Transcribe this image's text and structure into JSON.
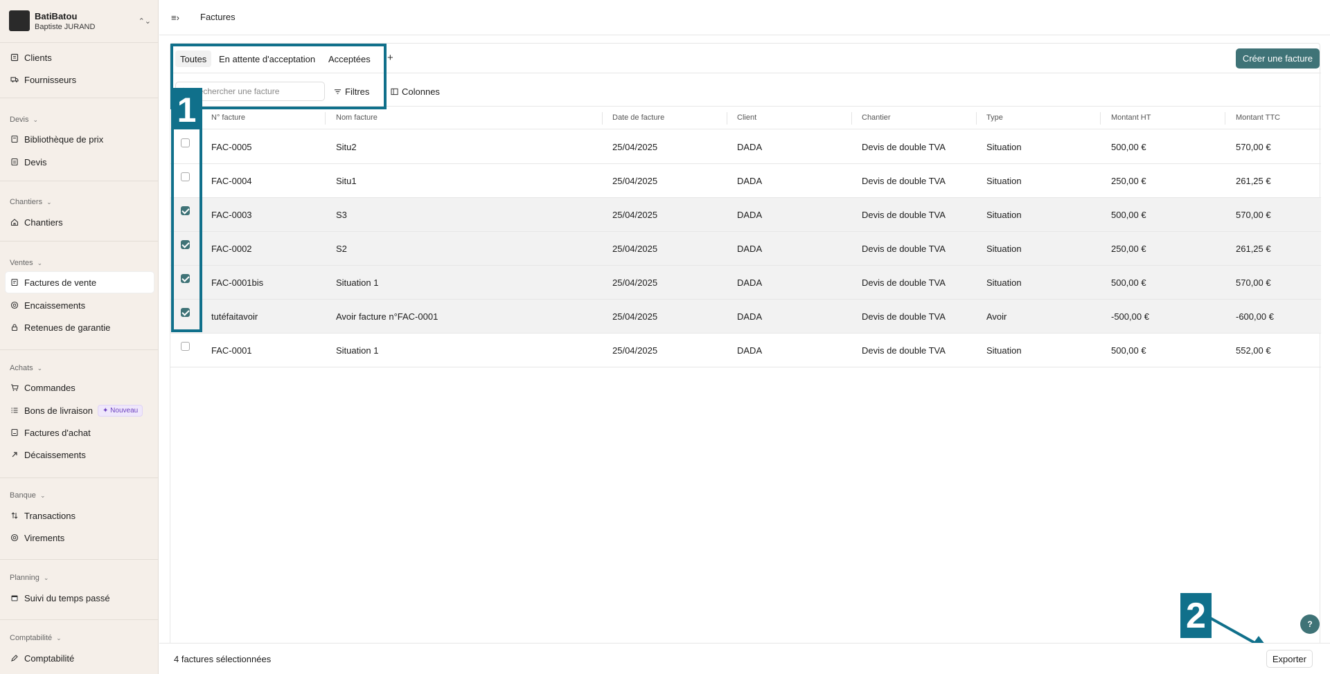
{
  "company": {
    "name": "BatiBatou",
    "user": "Baptiste JURAND"
  },
  "sidebar": {
    "top_items": [
      {
        "label": "Clients",
        "icon": "clients-icon"
      },
      {
        "label": "Fournisseurs",
        "icon": "truck-icon"
      }
    ],
    "sections": [
      {
        "label": "Devis",
        "items": [
          {
            "label": "Bibliothèque de prix",
            "icon": "book-icon"
          },
          {
            "label": "Devis",
            "icon": "document-icon"
          }
        ]
      },
      {
        "label": "Chantiers",
        "items": [
          {
            "label": "Chantiers",
            "icon": "house-icon"
          }
        ]
      },
      {
        "label": "Ventes",
        "items": [
          {
            "label": "Factures de vente",
            "icon": "invoice-icon",
            "active": true
          },
          {
            "label": "Encaissements",
            "icon": "coin-icon"
          },
          {
            "label": "Retenues de garantie",
            "icon": "lock-icon"
          }
        ]
      },
      {
        "label": "Achats",
        "items": [
          {
            "label": "Commandes",
            "icon": "cart-icon"
          },
          {
            "label": "Bons de livraison",
            "icon": "list-icon",
            "badge": "Nouveau"
          },
          {
            "label": "Factures d'achat",
            "icon": "invoice-icon"
          },
          {
            "label": "Décaissements",
            "icon": "arrow-up-right-icon"
          }
        ]
      },
      {
        "label": "Banque",
        "items": [
          {
            "label": "Transactions",
            "icon": "transfer-icon"
          },
          {
            "label": "Virements",
            "icon": "coin-icon"
          }
        ]
      },
      {
        "label": "Planning",
        "items": [
          {
            "label": "Suivi du temps passé",
            "icon": "calendar-icon"
          }
        ]
      },
      {
        "label": "Comptabilité",
        "items": [
          {
            "label": "Comptabilité",
            "icon": "pen-icon"
          }
        ]
      }
    ]
  },
  "header": {
    "title": "Factures"
  },
  "tabs": [
    "Toutes",
    "En attente d'acceptation",
    "Acceptées"
  ],
  "create_button": "Créer une facture",
  "search": {
    "placeholder": "Rechercher une facture"
  },
  "filters_label": "Filtres",
  "columns_label": "Colonnes",
  "table": {
    "columns": [
      "N° facture",
      "Nom facture",
      "Date de facture",
      "Client",
      "Chantier",
      "Type",
      "Montant HT",
      "Montant TTC"
    ],
    "rows": [
      {
        "checked": false,
        "cells": [
          "FAC-0005",
          "Situ2",
          "25/04/2025",
          "DADA",
          "Devis de double TVA",
          "Situation",
          "500,00 €",
          "570,00 €"
        ]
      },
      {
        "checked": false,
        "cells": [
          "FAC-0004",
          "Situ1",
          "25/04/2025",
          "DADA",
          "Devis de double TVA",
          "Situation",
          "250,00 €",
          "261,25 €"
        ]
      },
      {
        "checked": true,
        "cells": [
          "FAC-0003",
          "S3",
          "25/04/2025",
          "DADA",
          "Devis de double TVA",
          "Situation",
          "500,00 €",
          "570,00 €"
        ]
      },
      {
        "checked": true,
        "cells": [
          "FAC-0002",
          "S2",
          "25/04/2025",
          "DADA",
          "Devis de double TVA",
          "Situation",
          "250,00 €",
          "261,25 €"
        ]
      },
      {
        "checked": true,
        "cells": [
          "FAC-0001bis",
          "Situation 1",
          "25/04/2025",
          "DADA",
          "Devis de double TVA",
          "Situation",
          "500,00 €",
          "570,00 €"
        ]
      },
      {
        "checked": true,
        "cells": [
          "tutéfaitavoir",
          "Avoir facture n°FAC-0001",
          "25/04/2025",
          "DADA",
          "Devis de double TVA",
          "Avoir",
          "-500,00 €",
          "-600,00 €"
        ]
      },
      {
        "checked": false,
        "cells": [
          "FAC-0001",
          "Situation 1",
          "25/04/2025",
          "DADA",
          "Devis de double TVA",
          "Situation",
          "500,00 €",
          "552,00 €"
        ]
      }
    ]
  },
  "footer": {
    "selection_text": "4 factures sélectionnées",
    "export_label": "Exporter"
  },
  "help_label": "?",
  "annotations": {
    "one": "1",
    "two": "2"
  },
  "colors": {
    "accent": "#3f7377",
    "annotation": "#10708b",
    "sidebar_bg": "#f5efe9"
  }
}
